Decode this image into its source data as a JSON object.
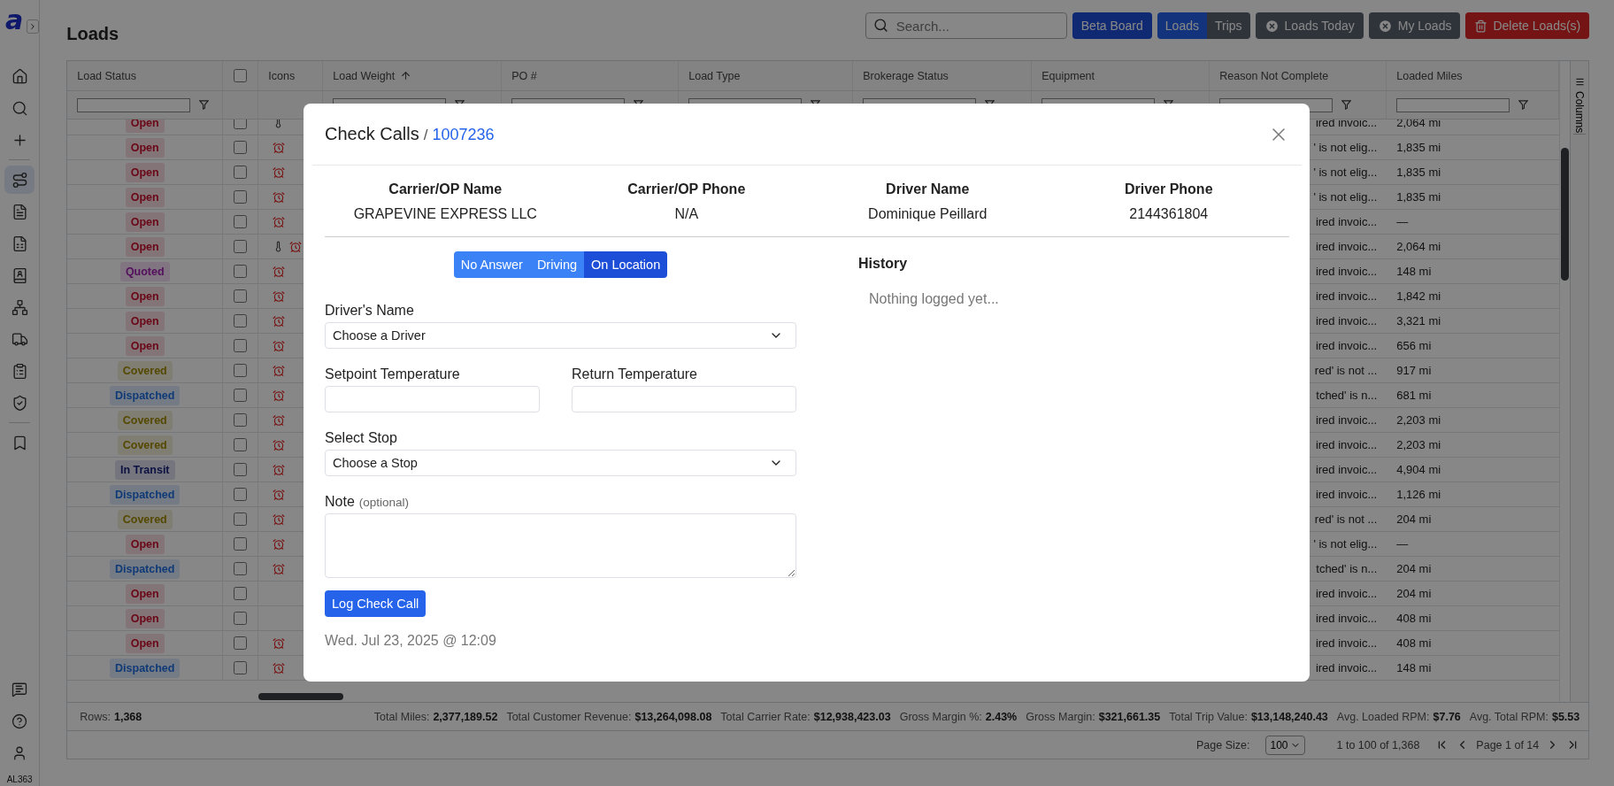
{
  "sidebar": {
    "logo": "a",
    "groups": [
      [
        {
          "selected": false
        },
        {
          "selected": false
        },
        {
          "selected": false
        }
      ],
      [
        {
          "selected": true
        },
        {
          "selected": false
        },
        {
          "selected": false
        },
        {
          "selected": false
        },
        {
          "selected": false
        },
        {
          "selected": false
        },
        {
          "selected": false
        },
        {
          "selected": false
        }
      ],
      [
        {
          "selected": false
        }
      ]
    ],
    "bottom_items": [
      {
        "selected": false
      },
      {
        "selected": false
      },
      {
        "selected": false
      }
    ],
    "user_code": "AL363"
  },
  "page_title": "Loads",
  "toolbar": {
    "search": {
      "placeholder": "Search..."
    },
    "buttons": [
      {
        "label": "Beta Board",
        "kind": "primary"
      }
    ],
    "view_toggle": [
      {
        "label": "Loads",
        "selected": true
      },
      {
        "label": "Trips",
        "selected": false
      }
    ],
    "actions": [
      {
        "label": "Loads Today",
        "kind": "clear"
      },
      {
        "label": "My Loads",
        "kind": "clear"
      },
      {
        "label": "Delete Loads(s)",
        "kind": "danger"
      }
    ]
  },
  "table": {
    "header_checkbox": {
      "checked": false
    },
    "columns": [
      {
        "kind": "text",
        "label": "Load Status",
        "sorted_ascending": false,
        "filterable": true
      },
      {
        "kind": "checkbox",
        "filterable": false
      },
      {
        "kind": "text",
        "label": "Icons",
        "sorted_ascending": false,
        "filterable": false
      },
      {
        "kind": "text",
        "label": "Load Weight",
        "sorted_ascending": true,
        "filterable": true
      },
      {
        "kind": "text",
        "label": "PO #",
        "sorted_ascending": false,
        "filterable": true
      },
      {
        "kind": "text",
        "label": "Load Type",
        "sorted_ascending": false,
        "filterable": true
      },
      {
        "kind": "text",
        "label": "Brokerage Status",
        "sorted_ascending": false,
        "filterable": true
      },
      {
        "kind": "text",
        "label": "Equipment",
        "sorted_ascending": false,
        "filterable": true
      },
      {
        "kind": "text",
        "label": "Reason Not Complete",
        "sorted_ascending": false,
        "filterable": true
      },
      {
        "kind": "text",
        "label": "Loaded Miles",
        "sorted_ascending": false,
        "filterable": true
      }
    ],
    "rows": [
      {
        "status": "Open",
        "kind": "open",
        "checked": false,
        "thermometer": true,
        "alarm": false,
        "reason": "ired invoic...",
        "loaded_miles": "2,064 mi"
      },
      {
        "status": "Open",
        "kind": "open",
        "checked": false,
        "thermometer": false,
        "alarm": true,
        "reason": "' is not elig...",
        "loaded_miles": "1,835 mi"
      },
      {
        "status": "Open",
        "kind": "open",
        "checked": false,
        "thermometer": false,
        "alarm": true,
        "reason": "' is not elig...",
        "loaded_miles": "1,835 mi"
      },
      {
        "status": "Open",
        "kind": "open",
        "checked": false,
        "thermometer": false,
        "alarm": true,
        "reason": "' is not elig...",
        "loaded_miles": "1,835 mi"
      },
      {
        "status": "Open",
        "kind": "open",
        "checked": false,
        "thermometer": false,
        "alarm": true,
        "reason": "ired invoic...",
        "loaded_miles": "—"
      },
      {
        "status": "Open",
        "kind": "open",
        "checked": false,
        "thermometer": true,
        "alarm": true,
        "reason": "ired invoic...",
        "loaded_miles": "2,064 mi"
      },
      {
        "status": "Quoted",
        "kind": "quoted",
        "checked": false,
        "thermometer": false,
        "alarm": true,
        "reason": "ired invoic...",
        "loaded_miles": "148 mi"
      },
      {
        "status": "Open",
        "kind": "open",
        "checked": false,
        "thermometer": false,
        "alarm": true,
        "reason": "ired invoic...",
        "loaded_miles": "1,842 mi"
      },
      {
        "status": "Open",
        "kind": "open",
        "checked": false,
        "thermometer": false,
        "alarm": true,
        "reason": "ired invoic...",
        "loaded_miles": "3,321 mi"
      },
      {
        "status": "Open",
        "kind": "open",
        "checked": false,
        "thermometer": false,
        "alarm": true,
        "reason": "ired invoic...",
        "loaded_miles": "656 mi"
      },
      {
        "status": "Covered",
        "kind": "covered",
        "checked": false,
        "thermometer": false,
        "alarm": true,
        "reason": "red' is not ...",
        "loaded_miles": "917 mi"
      },
      {
        "status": "Dispatched",
        "kind": "dispatched",
        "checked": false,
        "thermometer": false,
        "alarm": true,
        "reason": "tched' is n...",
        "loaded_miles": "681 mi"
      },
      {
        "status": "Covered",
        "kind": "covered",
        "checked": false,
        "thermometer": false,
        "alarm": true,
        "reason": "ired invoic...",
        "loaded_miles": "2,203 mi"
      },
      {
        "status": "Covered",
        "kind": "covered",
        "checked": false,
        "thermometer": false,
        "alarm": true,
        "reason": "ired invoic...",
        "loaded_miles": "2,203 mi"
      },
      {
        "status": "In Transit",
        "kind": "transit",
        "checked": false,
        "thermometer": false,
        "alarm": true,
        "reason": "ired invoic...",
        "loaded_miles": "4,904 mi"
      },
      {
        "status": "Dispatched",
        "kind": "dispatched",
        "checked": false,
        "thermometer": false,
        "alarm": true,
        "reason": "ired invoic...",
        "loaded_miles": "1,126 mi"
      },
      {
        "status": "Covered",
        "kind": "covered",
        "checked": false,
        "thermometer": false,
        "alarm": true,
        "reason": "red' is not ...",
        "loaded_miles": "204 mi"
      },
      {
        "status": "Open",
        "kind": "open",
        "checked": false,
        "thermometer": false,
        "alarm": true,
        "reason": "' is not elig...",
        "loaded_miles": "—"
      },
      {
        "status": "Dispatched",
        "kind": "dispatched",
        "checked": false,
        "thermometer": false,
        "alarm": true,
        "reason": "tched' is n...",
        "loaded_miles": "204 mi"
      },
      {
        "status": "Open",
        "kind": "open",
        "checked": false,
        "thermometer": false,
        "alarm": false,
        "reason": "ired invoic...",
        "loaded_miles": "204 mi"
      },
      {
        "status": "Open",
        "kind": "open",
        "checked": false,
        "thermometer": false,
        "alarm": false,
        "reason": "ired invoic...",
        "loaded_miles": "408 mi"
      },
      {
        "status": "Open",
        "kind": "open",
        "checked": false,
        "thermometer": false,
        "alarm": true,
        "reason": "ired invoic...",
        "loaded_miles": "408 mi"
      },
      {
        "status": "Dispatched",
        "kind": "dispatched",
        "checked": false,
        "thermometer": false,
        "alarm": true,
        "reason": "ired invoic...",
        "loaded_miles": "148 mi"
      }
    ],
    "columns_tab": "Columns"
  },
  "footer": {
    "rows_label": "Rows:",
    "rows_value": "1,368",
    "totals": [
      {
        "label": "Total Miles:",
        "value": "2,377,189.52"
      },
      {
        "label": "Total Customer Revenue:",
        "value": "$13,264,098.08"
      },
      {
        "label": "Total Carrier Rate:",
        "value": "$12,938,423.03"
      },
      {
        "label": "Gross Margin %:",
        "value": "2.43%"
      },
      {
        "label": "Gross Margin:",
        "value": "$321,661.35"
      },
      {
        "label": "Total Trip Value:",
        "value": "$13,148,240.43"
      },
      {
        "label": "Avg. Loaded RPM:",
        "value": "$7.76"
      },
      {
        "label": "Avg. Total RPM:",
        "value": "$5.53"
      }
    ]
  },
  "pagination": {
    "page_size_label": "Page Size:",
    "page_size": "100",
    "range": "1 to 100 of 1,368",
    "page": "Page 1 of 14"
  },
  "modal": {
    "title": "Check Calls",
    "separator": "/",
    "load_number": "1007236",
    "info": [
      {
        "label": "Carrier/OP Name",
        "value": "GRAPEVINE EXPRESS LLC"
      },
      {
        "label": "Carrier/OP Phone",
        "value": "N/A"
      },
      {
        "label": "Driver Name",
        "value": "Dominique Peillard"
      },
      {
        "label": "Driver Phone",
        "value": "2144361804"
      }
    ],
    "status_buttons": [
      {
        "label": "No Answer",
        "selected": false
      },
      {
        "label": "Driving",
        "selected": false
      },
      {
        "label": "On Location",
        "selected": true
      }
    ],
    "driver_select": {
      "label": "Driver's Name",
      "value": "Choose a Driver"
    },
    "temperatures": [
      {
        "label": "Setpoint Temperature"
      },
      {
        "label": "Return Temperature"
      }
    ],
    "stop_select": {
      "label": "Select Stop",
      "value": "Choose a Stop"
    },
    "note": {
      "label": "Note",
      "hint": "(optional)"
    },
    "submit": "Log Check Call",
    "timestamp": "Wed. Jul 23, 2025 @ 12:09",
    "history": {
      "title": "History",
      "empty_text": "Nothing logged yet..."
    }
  }
}
